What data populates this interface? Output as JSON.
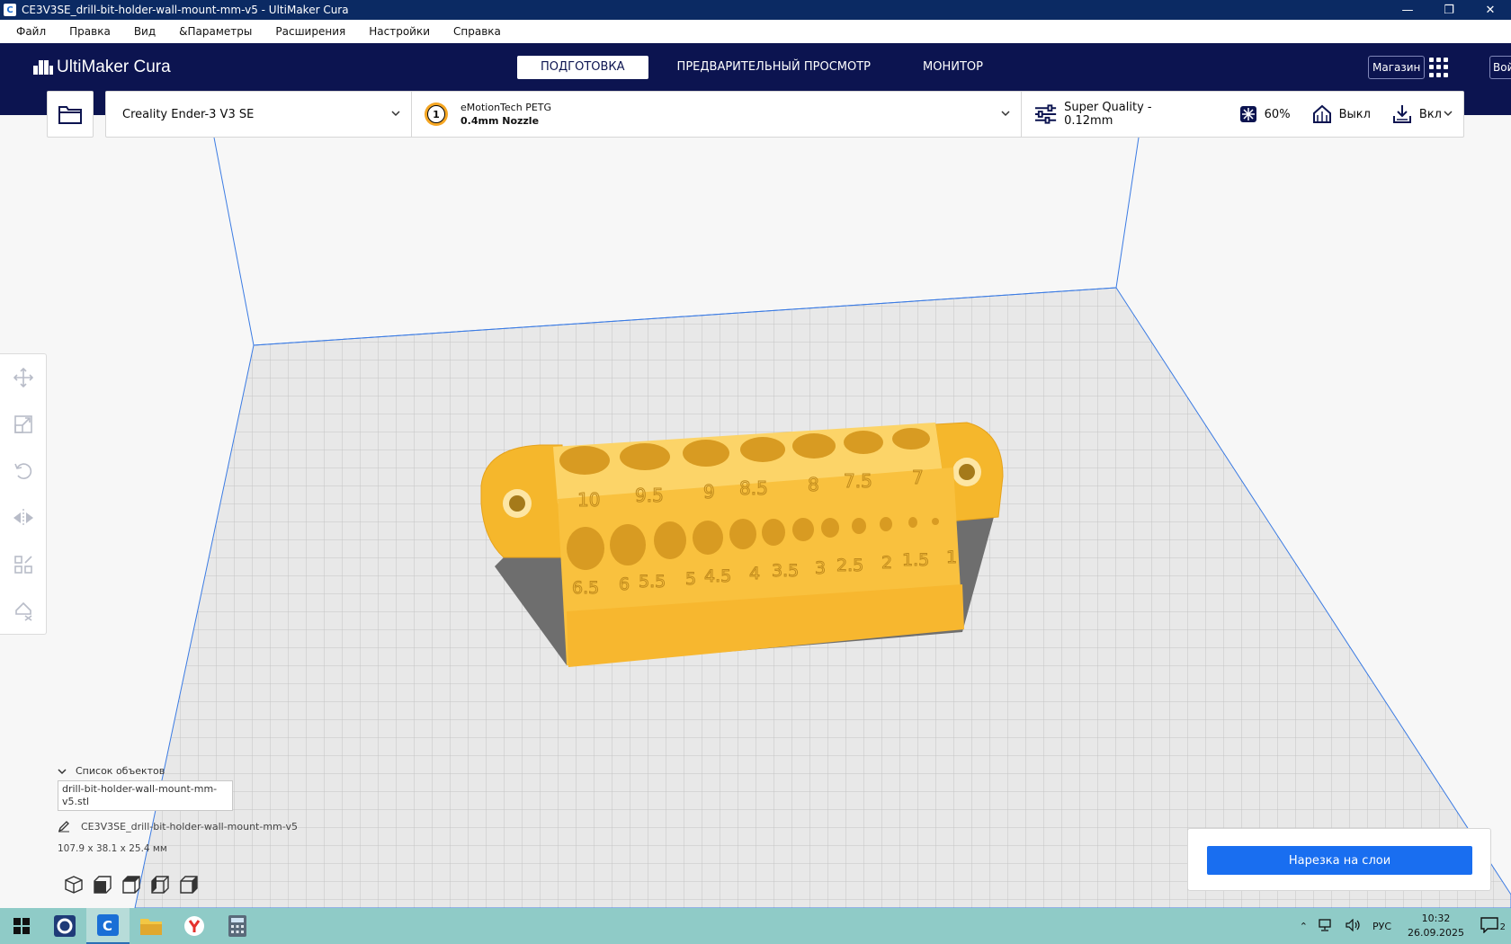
{
  "window": {
    "title": "CE3V3SE_drill-bit-holder-wall-mount-mm-v5 - UltiMaker Cura"
  },
  "menu": [
    "Файл",
    "Правка",
    "Вид",
    "&Параметры",
    "Расширения",
    "Настройки",
    "Справка"
  ],
  "header": {
    "logo": "UltiMaker Cura",
    "stages": [
      "ПОДГОТОВКА",
      "ПРЕДВАРИТЕЛЬНЫЙ ПРОСМОТР",
      "МОНИТОР"
    ],
    "marketplace": "Магазин",
    "signin": "Войти"
  },
  "toolbar": {
    "printer": "Creality Ender-3 V3 SE",
    "extruder_number": "1",
    "material": "eMotionTech PETG",
    "nozzle": "0.4mm Nozzle",
    "profile": "Super Quality - 0.12mm",
    "infill": "60%",
    "support": "Выкл",
    "adhesion": "Вкл"
  },
  "objects": {
    "header": "Список объектов",
    "file": "drill-bit-holder-wall-mount-mm-v5.stl",
    "job_name": "CE3V3SE_drill-bit-holder-wall-mount-mm-v5",
    "dimensions": "107.9 x 38.1 x 25.4 мм"
  },
  "model": {
    "top_labels": [
      "10",
      "9.5",
      "9",
      "8.5",
      "8",
      "7.5",
      "7"
    ],
    "front_labels": [
      "6.5",
      "6",
      "5.5",
      "5",
      "4.5",
      "4",
      "3.5",
      "3",
      "2.5",
      "2",
      "1.5",
      "1"
    ],
    "color": "#f9c13e"
  },
  "slice": {
    "button": "Нарезка на слои"
  },
  "taskbar": {
    "lang": "РУС",
    "time": "10:32",
    "date": "26.09.2025",
    "notifications": "2"
  }
}
